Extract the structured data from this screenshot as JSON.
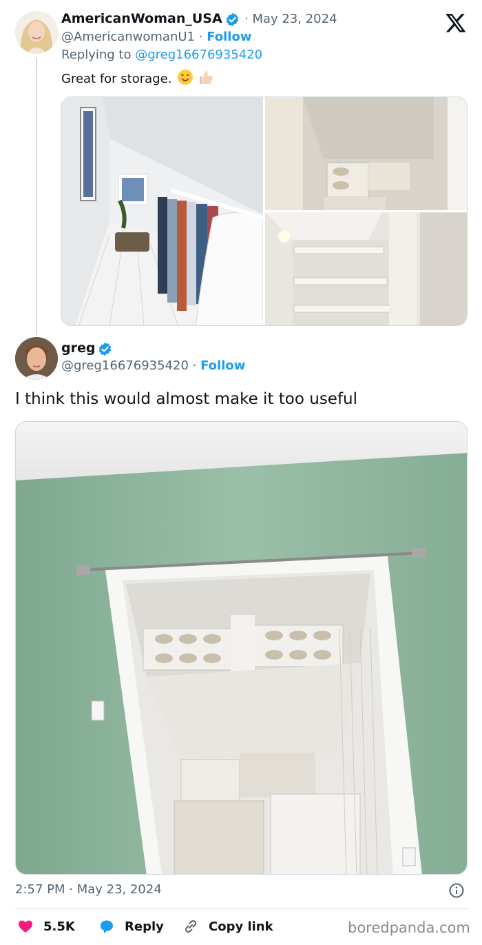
{
  "parent_tweet": {
    "author_name": "AmericanWoman_USA",
    "date": "· May 23, 2024",
    "handle": "@AmericanwomanU1",
    "separator": "·",
    "follow_label": "Follow",
    "replying_prefix": "Replying to",
    "replying_handle": "@greg16676935420",
    "text": "Great for storage.",
    "emojis": [
      "smiling-face-emoji",
      "thumbs-up-emoji"
    ]
  },
  "reply_tweet": {
    "author_name": "greg",
    "handle": "@greg16676935420",
    "separator": "·",
    "follow_label": "Follow",
    "text": "I think this would almost make it too useful",
    "timestamp": "2:57 PM · May 23, 2024"
  },
  "actions": {
    "likes_count": "5.5K",
    "reply_label": "Reply",
    "copy_link_label": "Copy link"
  },
  "watermark": "boredpanda.com",
  "colors": {
    "accent": "#1d9bf0",
    "like": "#f91880",
    "text": "#0f1419",
    "muted": "#536471",
    "wall_green": "#8fb29c"
  },
  "icons": [
    "x-logo-icon",
    "verified-badge-icon",
    "info-icon",
    "heart-icon",
    "reply-icon",
    "link-icon"
  ]
}
